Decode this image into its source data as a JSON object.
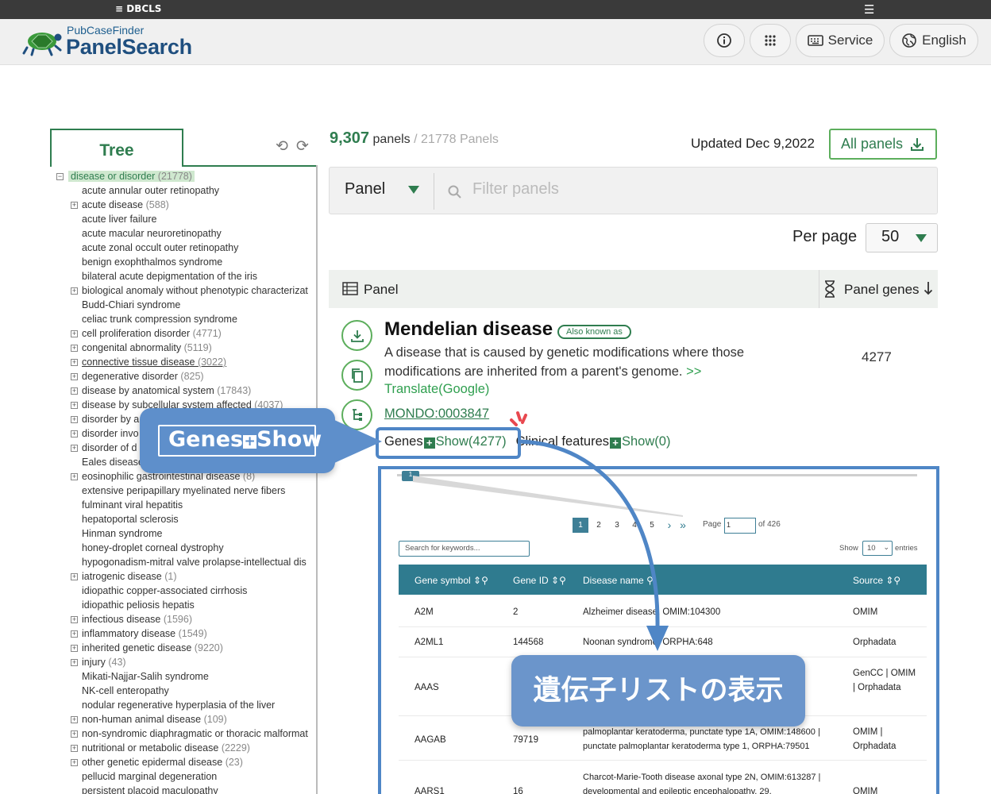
{
  "topbar": {
    "org": "DBCLS",
    "menu_icon": "hamburger-icon"
  },
  "header": {
    "brand_small": "PubCaseFinder",
    "brand_big": "PanelSearch",
    "service": "Service",
    "language": "English"
  },
  "tree": {
    "tab": "Tree",
    "root": {
      "label": "disease or disorder",
      "count": "(21778)"
    },
    "items": [
      {
        "label": "acute annular outer retinopathy",
        "count": "",
        "exp": false
      },
      {
        "label": "acute disease",
        "count": "(588)",
        "exp": true
      },
      {
        "label": "acute liver failure",
        "count": "",
        "exp": false
      },
      {
        "label": "acute macular neuroretinopathy",
        "count": "",
        "exp": false
      },
      {
        "label": "acute zonal occult outer retinopathy",
        "count": "",
        "exp": false
      },
      {
        "label": "benign exophthalmos syndrome",
        "count": "",
        "exp": false
      },
      {
        "label": "bilateral acute depigmentation of the iris",
        "count": "",
        "exp": false
      },
      {
        "label": "biological anomaly without phenotypic characterizat",
        "count": "",
        "exp": true
      },
      {
        "label": "Budd-Chiari syndrome",
        "count": "",
        "exp": false
      },
      {
        "label": "celiac trunk compression syndrome",
        "count": "",
        "exp": false
      },
      {
        "label": "cell proliferation disorder",
        "count": "(4771)",
        "exp": true
      },
      {
        "label": "congenital abnormality",
        "count": "(5119)",
        "exp": true
      },
      {
        "label": "connective tissue disease",
        "count": "(3022)",
        "exp": true,
        "ul": true
      },
      {
        "label": "degenerative disorder",
        "count": "(825)",
        "exp": true
      },
      {
        "label": "disease by anatomical system",
        "count": "(17843)",
        "exp": true
      },
      {
        "label": "disease by subcellular system affected",
        "count": "(4037)",
        "exp": true
      },
      {
        "label": "disorder by a",
        "count": "",
        "exp": true
      },
      {
        "label": "disorder invo",
        "count": "",
        "exp": true
      },
      {
        "label": "disorder of d",
        "count": "",
        "exp": true
      },
      {
        "label": "Eales disease",
        "count": "",
        "exp": false
      },
      {
        "label": "eosinophilic gastrointestinal disease",
        "count": "(8)",
        "exp": true
      },
      {
        "label": "extensive peripapillary myelinated nerve fibers",
        "count": "",
        "exp": false
      },
      {
        "label": "fulminant viral hepatitis",
        "count": "",
        "exp": false
      },
      {
        "label": "hepatoportal sclerosis",
        "count": "",
        "exp": false
      },
      {
        "label": "Hinman syndrome",
        "count": "",
        "exp": false
      },
      {
        "label": "honey-droplet corneal dystrophy",
        "count": "",
        "exp": false
      },
      {
        "label": "hypogonadism-mitral valve prolapse-intellectual dis",
        "count": "",
        "exp": false
      },
      {
        "label": "iatrogenic disease",
        "count": "(1)",
        "exp": true
      },
      {
        "label": "idiopathic copper-associated cirrhosis",
        "count": "",
        "exp": false
      },
      {
        "label": "idiopathic peliosis hepatis",
        "count": "",
        "exp": false
      },
      {
        "label": "infectious disease",
        "count": "(1596)",
        "exp": true
      },
      {
        "label": "inflammatory disease",
        "count": "(1549)",
        "exp": true
      },
      {
        "label": "inherited genetic disease",
        "count": "(9220)",
        "exp": true
      },
      {
        "label": "injury",
        "count": "(43)",
        "exp": true
      },
      {
        "label": "Mikati-Najjar-Salih syndrome",
        "count": "",
        "exp": false
      },
      {
        "label": "NK-cell enteropathy",
        "count": "",
        "exp": false
      },
      {
        "label": "nodular regenerative hyperplasia of the liver",
        "count": "",
        "exp": false
      },
      {
        "label": "non-human animal disease",
        "count": "(109)",
        "exp": true
      },
      {
        "label": "non-syndromic diaphragmatic or thoracic malformat",
        "count": "",
        "exp": true
      },
      {
        "label": "nutritional or metabolic disease",
        "count": "(2229)",
        "exp": true
      },
      {
        "label": "other genetic epidermal disease",
        "count": "(23)",
        "exp": true
      },
      {
        "label": "pellucid marginal degeneration",
        "count": "",
        "exp": false
      },
      {
        "label": "persistent placoid maculopathy",
        "count": "",
        "exp": false
      }
    ]
  },
  "summary": {
    "count": "9,307",
    "panels_word": "panels",
    "total": "/ 21778 Panels",
    "updated": "Updated Dec 9,2022",
    "all_panels": "All panels"
  },
  "filter": {
    "select": "Panel",
    "placeholder": "Filter panels"
  },
  "perpage": {
    "label": "Per page",
    "value": "50"
  },
  "table_head": {
    "panel": "Panel",
    "panel_genes": "Panel genes"
  },
  "panel": {
    "title": "Mendelian disease",
    "aka": "Also known as",
    "desc": "A disease that is caused by genetic modifications where those modifications are inherited from a parent's genome.",
    "more": ">>",
    "translate": "Translate(Google)",
    "mondo": "MONDO:0003847",
    "genes_count": "4277",
    "genes_label": "Genes",
    "genes_show": "Show(4277)",
    "clinical_label": "Clinical features",
    "clinical_show": "Show(0)"
  },
  "inset": {
    "scroll_tag": "1",
    "pages": [
      "1",
      "2",
      "3",
      "4",
      "5"
    ],
    "page_label": "Page",
    "page_value": "1",
    "page_of": "of 426",
    "search_placeholder": "Search for keywords...",
    "show_label": "Show",
    "show_value": "10",
    "entries_label": "entries",
    "columns": [
      "Gene symbol",
      "Gene ID",
      "Disease name",
      "Source"
    ],
    "rows": [
      {
        "symbol": "A2M",
        "id": "2",
        "disease": "Alzheimer disease, OMIM:104300",
        "source": "OMIM"
      },
      {
        "symbol": "A2ML1",
        "id": "144568",
        "disease": "Noonan syndrome, ORPHA:648",
        "source": "Orphadata"
      },
      {
        "symbol": "AAAS",
        "id": "",
        "disease": "",
        "source": "GenCC | OMIM | Orphadata"
      },
      {
        "symbol": "AAGAB",
        "id": "79719",
        "disease": "palmoplantar keratoderma, punctate type 1A, OMIM:148600 | punctate palmoplantar keratoderma type 1, ORPHA:79501",
        "source": "OMIM | Orphadata"
      },
      {
        "symbol": "AARS1",
        "id": "16",
        "disease": "Charcot-Marie-Tooth disease axonal type 2N, OMIM:613287 | developmental and epileptic encephalopathy, 29,",
        "source": "OMIM"
      }
    ]
  },
  "callouts": {
    "genes_show_a": "Genes",
    "genes_show_b": "Show",
    "gene_list": "遺伝子リストの表示"
  },
  "colors": {
    "green": "#2f7d4f",
    "callout_blue": "#5e8fcb",
    "table_teal": "#2f7b8f"
  }
}
